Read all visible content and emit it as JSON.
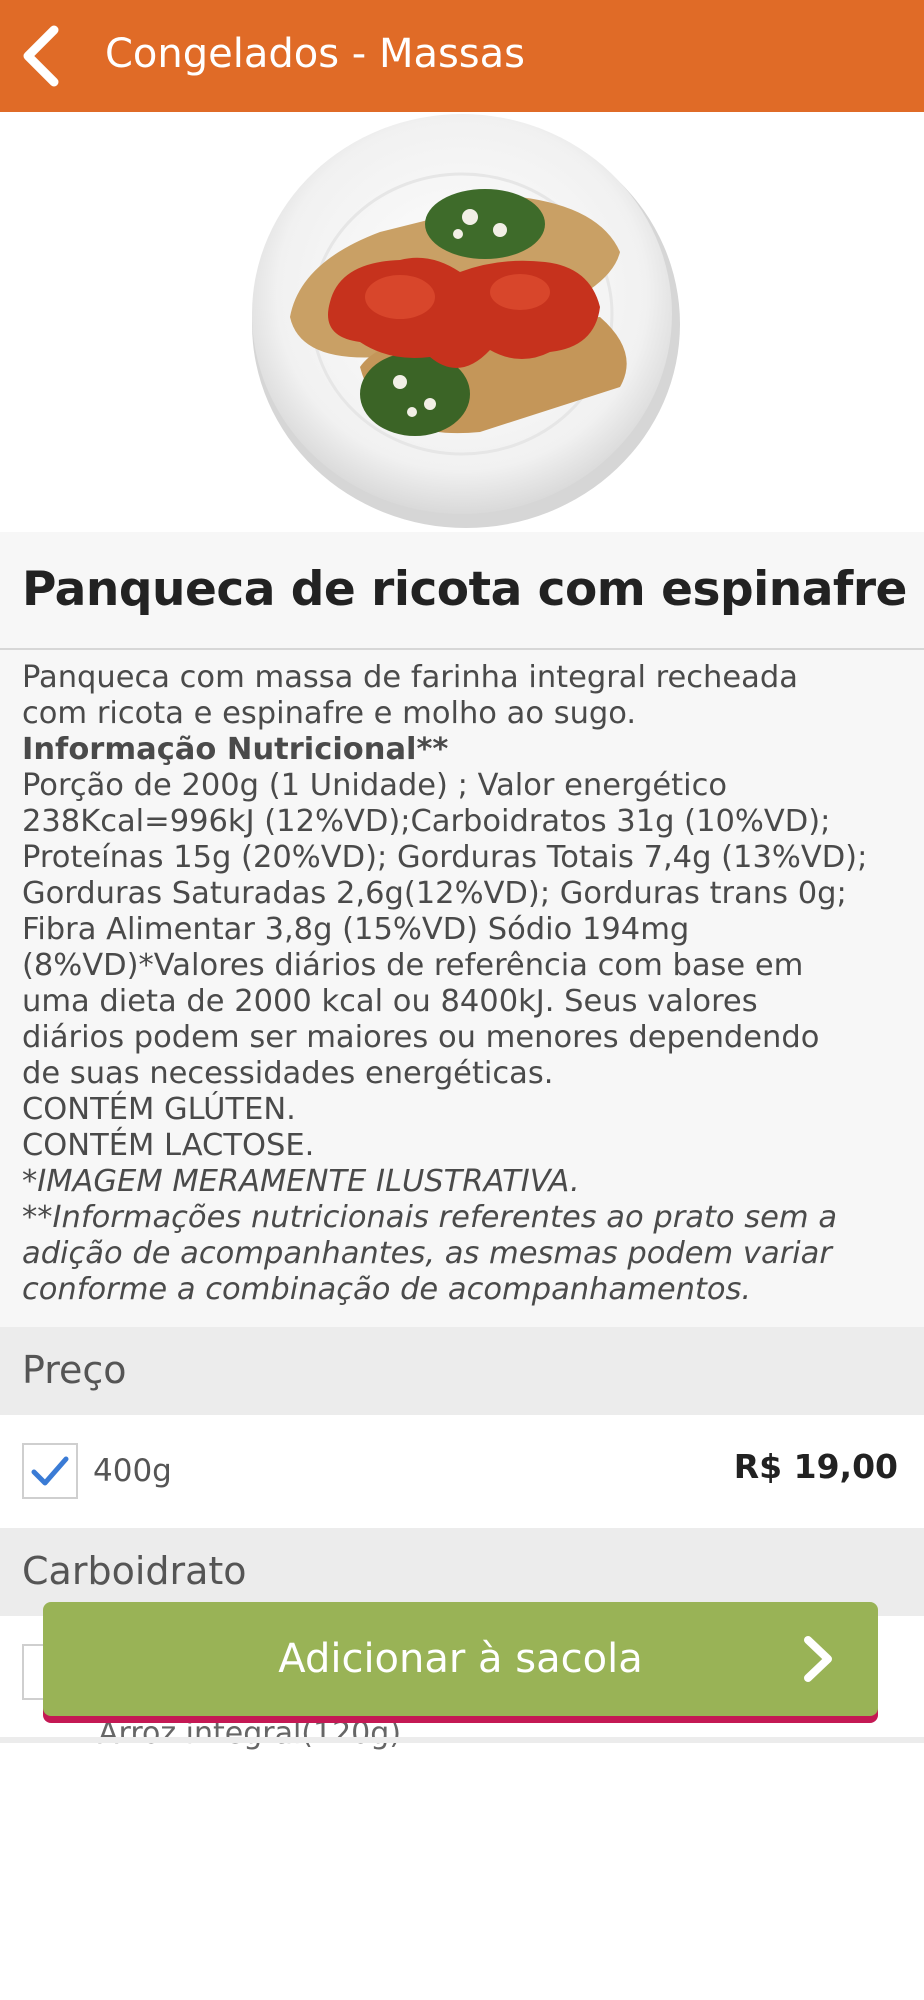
{
  "header": {
    "title": "Congelados - Massas",
    "background": "#e06b27"
  },
  "product": {
    "image_icon": "plate-pancake-image",
    "title": "Panqueca de ricota com espinafre",
    "description_lines": [
      "Panqueca com massa de farinha integral recheada",
      "com ricota e espinafre e molho ao sugo."
    ],
    "nutrition_title": "Informação Nutricional**",
    "nutrition_lines": [
      "Porção de 200g (1 Unidade) ; Valor energético",
      "238Kcal=996kJ (12%VD);Carboidratos 31g (10%VD);",
      "Proteínas 15g (20%VD); Gorduras Totais 7,4g (13%VD);",
      "Gorduras Saturadas 2,6g(12%VD); Gorduras trans 0g;",
      "Fibra Alimentar 3,8g (15%VD) Sódio 194mg",
      "(8%VD)*Valores diários de referência com base em",
      "uma dieta de 2000 kcal ou 8400kJ. Seus valores",
      "diários podem ser maiores ou menores dependendo",
      "de suas necessidades energéticas."
    ],
    "allergen_lines": [
      "CONTÉM GLÚTEN.",
      "CONTÉM LACTOSE."
    ],
    "notes_italic": [
      "*IMAGEM MERAMENTE ILUSTRATIVA.",
      "**Informações nutricionais referentes ao prato sem a",
      "adição de acompanhantes, as mesmas podem variar",
      "conforme a combinação de acompanhamentos."
    ]
  },
  "price_section": {
    "heading": "Preço",
    "option": {
      "label": "400g",
      "price": "R$ 19,00",
      "checked": true
    }
  },
  "carb_section": {
    "heading": "Carboidrato",
    "option": {
      "label": "Arroz integral(120g)",
      "checked": false
    }
  },
  "add_button": {
    "label": "Adicionar à sacola",
    "color": "#99b356",
    "accent": "#c41954"
  },
  "icons": {
    "back": "chevron-left-icon",
    "check": "check-icon",
    "forward": "chevron-right-icon"
  }
}
